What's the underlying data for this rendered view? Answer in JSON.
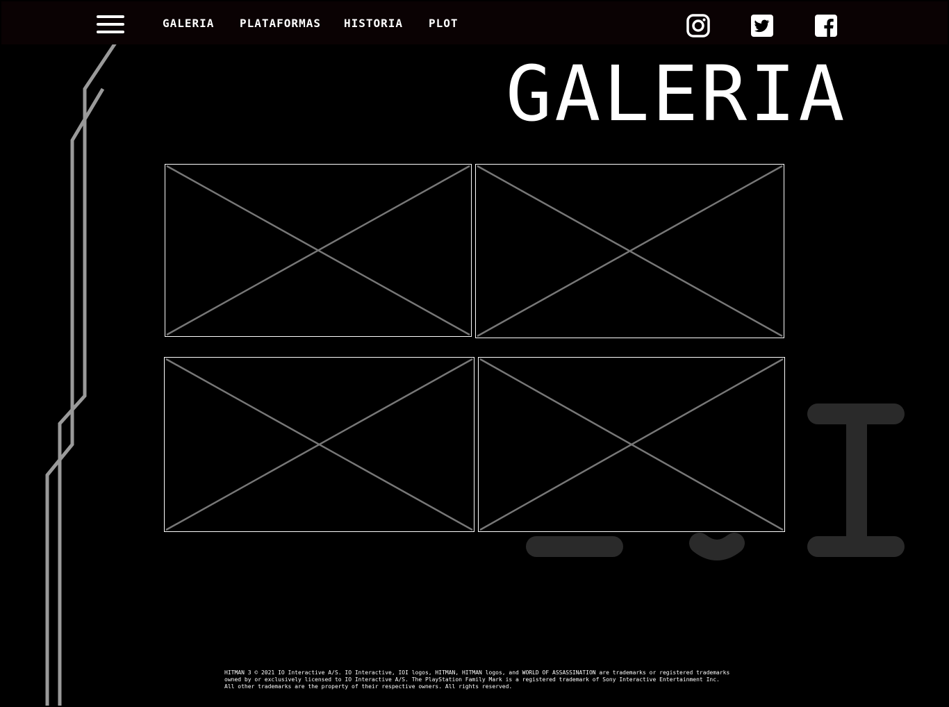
{
  "nav": {
    "menu_icon": "hamburger-menu-icon",
    "links": [
      {
        "label": "GALERIA"
      },
      {
        "label": "PLATAFORMAS"
      },
      {
        "label": "HISTORIA"
      },
      {
        "label": "PLOT"
      }
    ],
    "social": [
      {
        "icon": "instagram-icon"
      },
      {
        "icon": "twitter-icon"
      },
      {
        "icon": "facebook-icon"
      }
    ]
  },
  "page": {
    "title": "GALERIA"
  },
  "gallery": {
    "images": [
      {
        "state": "placeholder"
      },
      {
        "state": "placeholder"
      },
      {
        "state": "placeholder"
      },
      {
        "state": "placeholder"
      }
    ]
  },
  "footer": {
    "legal": "HITMAN 3 © 2021 IO Interactive A/S. IO Interactive, IOI logos, HITMAN, HITMAN logos, and WORLD OF ASSASSINATION are trademarks or registered trademarks owned by or exclusively licensed to IO Interactive A/S. The PlayStation Family Mark is a registered trademark of Sony Interactive Entertainment Inc. All other trademarks are the property of their respective owners. All rights reserved."
  },
  "colors": {
    "background": "#000000",
    "topbar": "#0a0203",
    "text": "#ffffff",
    "decor_line": "#9a9a9a",
    "watermark": "#2a2a2a",
    "placeholder_cross": "#777777"
  }
}
